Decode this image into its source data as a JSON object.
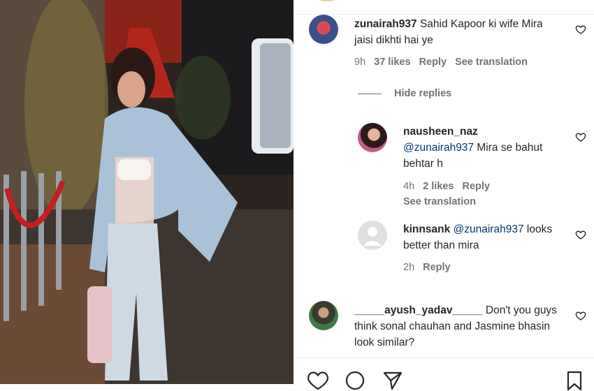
{
  "comments": [
    {
      "username": "zunairah937",
      "text": "Sahid Kapoor ki wife Mira jaisi dikhti hai ye",
      "time": "9h",
      "likes": "37 likes",
      "reply": "Reply",
      "see_translation": "See translation"
    }
  ],
  "hide_replies": "Hide replies",
  "replies": [
    {
      "username": "nausheen_naz",
      "mention": "@zunairah937",
      "text": "Mira se bahut behtar h",
      "time": "4h",
      "likes": "2 likes",
      "reply": "Reply",
      "see_translation": "See translation"
    },
    {
      "username": "kinnsank",
      "mention": "@zunairah937",
      "text": "looks better than mira",
      "time": "2h",
      "reply": "Reply"
    }
  ],
  "comment2": {
    "username": "_____ayush_yadav_____",
    "text": "Don't you guys think sonal chauhan and Jasmine bhasin look similar?"
  },
  "colors": {
    "mention": "#00376b",
    "muted": "#737373",
    "text": "#262626"
  },
  "icons": [
    "heart-icon",
    "comment-icon",
    "share-icon",
    "bookmark-icon"
  ]
}
